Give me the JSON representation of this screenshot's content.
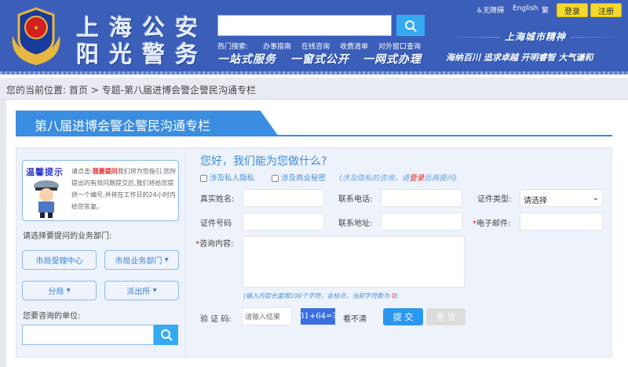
{
  "header": {
    "site_name_line1": "上海公安",
    "site_name_line2": "阳光警务",
    "search_placeholder": "",
    "hot_label": "热门搜索:",
    "hot_links": [
      "办事指南",
      "在线咨询",
      "收费清单",
      "对外窗口查询"
    ],
    "slogans": [
      "一站式服务",
      "一窗式公开",
      "一网式办理"
    ],
    "city_spirit_title": "上海城市精神",
    "city_spirit": "海纳百川 追求卓越 开明睿智 大气谦和",
    "accessibility": "无障碍",
    "english": "English",
    "traditional": "繁",
    "login": "登录",
    "register": "注册",
    "brand_color": "#3b5eb9"
  },
  "breadcrumb": {
    "label": "您的当前位置:",
    "home": "首页",
    "sep": ">",
    "current": "专题-第八届进博会警企警民沟通专栏"
  },
  "page_title": "第八届进博会警企警民沟通专栏",
  "tip": {
    "title": "温馨提示",
    "prefix": "请点击:",
    "link": "我要提问",
    "body": "我们将为您指引.您所提出的有效问题提交后,我们将给您提供一个编号,并将在工作日的24小时内给您答复。"
  },
  "left": {
    "dept_label": "请选择要提问的业务部门:",
    "depts": [
      "市局受理中心",
      "市局业务部门",
      "分局",
      "派出所"
    ],
    "unit_label": "您要咨询的单位:",
    "unit_value": ""
  },
  "form": {
    "greeting": "您好，我们能为您做什么?",
    "privacy": "涉及私人隐私",
    "secret": "涉及商业秘密",
    "note_pre": "(涉及隐私的咨询，请",
    "note_login": "登录",
    "note_post": "后再提问)",
    "name_label": "真实姓名:",
    "phone_label": "联系电话:",
    "idtype_label": "证件类型:",
    "idtype_value": "请选择",
    "idno_label": "证件号码",
    "address_label": "联系地址:",
    "email_label": "电子邮件:",
    "content_label": "咨询内容:",
    "limit_pre": "(输入内容长度限100个字符，含标点，当前字符数为 ",
    "limit_count": "0",
    "limit_post": ")",
    "captcha_label": "验 证 码:",
    "captcha_placeholder": "请输入结果",
    "captcha_image": "31+64=?",
    "refresh": "看不清",
    "submit": "提 交",
    "reset": "重 置"
  }
}
